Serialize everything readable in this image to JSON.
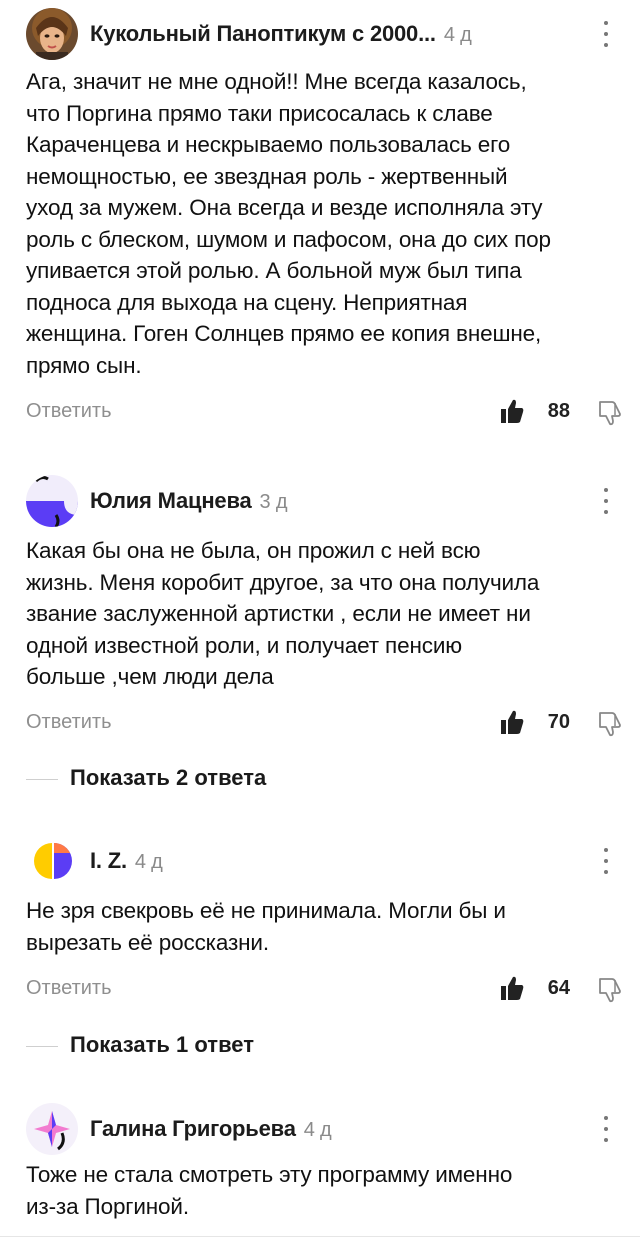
{
  "comments": [
    {
      "author": "Кукольный Паноптикум с 2000...",
      "age": "4 д",
      "text": "Ага, значит не мне одной!! Мне всегда казалось,\nчто Поргина прямо таки присосалась к славе\nКараченцева и нескрываемо пользовалась его\nнемощностью, ее звездная роль - жертвенный\nуход за мужем. Она всегда и везде исполняла эту\nроль с блеском, шумом и пафосом, она до сих пор\nупивается этой ролью. А больной муж был типа\nподноса для выхода на сцену. Неприятная\nженщина. Гоген Солнцев прямо ее копия внешне,\nпрямо сын.",
      "reply_label": "Ответить",
      "likes": "88",
      "avatar_icon": "doll-portrait-avatar"
    },
    {
      "author": "Юлия Мацнева",
      "age": "3 д",
      "text": "Какая бы она не была, он прожил с ней всю\nжизнь. Меня коробит другое, за что она получила\nзвание заслуженной артистки , если не имеет ни\nодной известной роли, и получает пенсию\nбольше ,чем люди дела",
      "reply_label": "Ответить",
      "likes": "70",
      "avatar_icon": "generated-avatar-purple"
    },
    {
      "author": "I. Z.",
      "age": "4 д",
      "text": "Не зря свекровь её не принимала. Могли бы и\nвырезать её россказни.",
      "reply_label": "Ответить",
      "likes": "64",
      "avatar_icon": "generated-avatar-yellow-purple"
    },
    {
      "author": "Галина Григорьева",
      "age": "4 д",
      "text": "Тоже не стала смотреть эту программу именно\nиз-за Поргиной.",
      "avatar_icon": "generated-avatar-pink-star"
    }
  ],
  "show_replies": [
    {
      "label": "Показать 2 ответа"
    },
    {
      "label": "Показать 1 ответ"
    }
  ],
  "colors": {
    "meta_gray": "#8a8a8a",
    "text": "#111111",
    "purple": "#5b3df5",
    "yellow": "#ffcc00",
    "pink": "#f27bd0",
    "orange": "#ff7a45"
  }
}
